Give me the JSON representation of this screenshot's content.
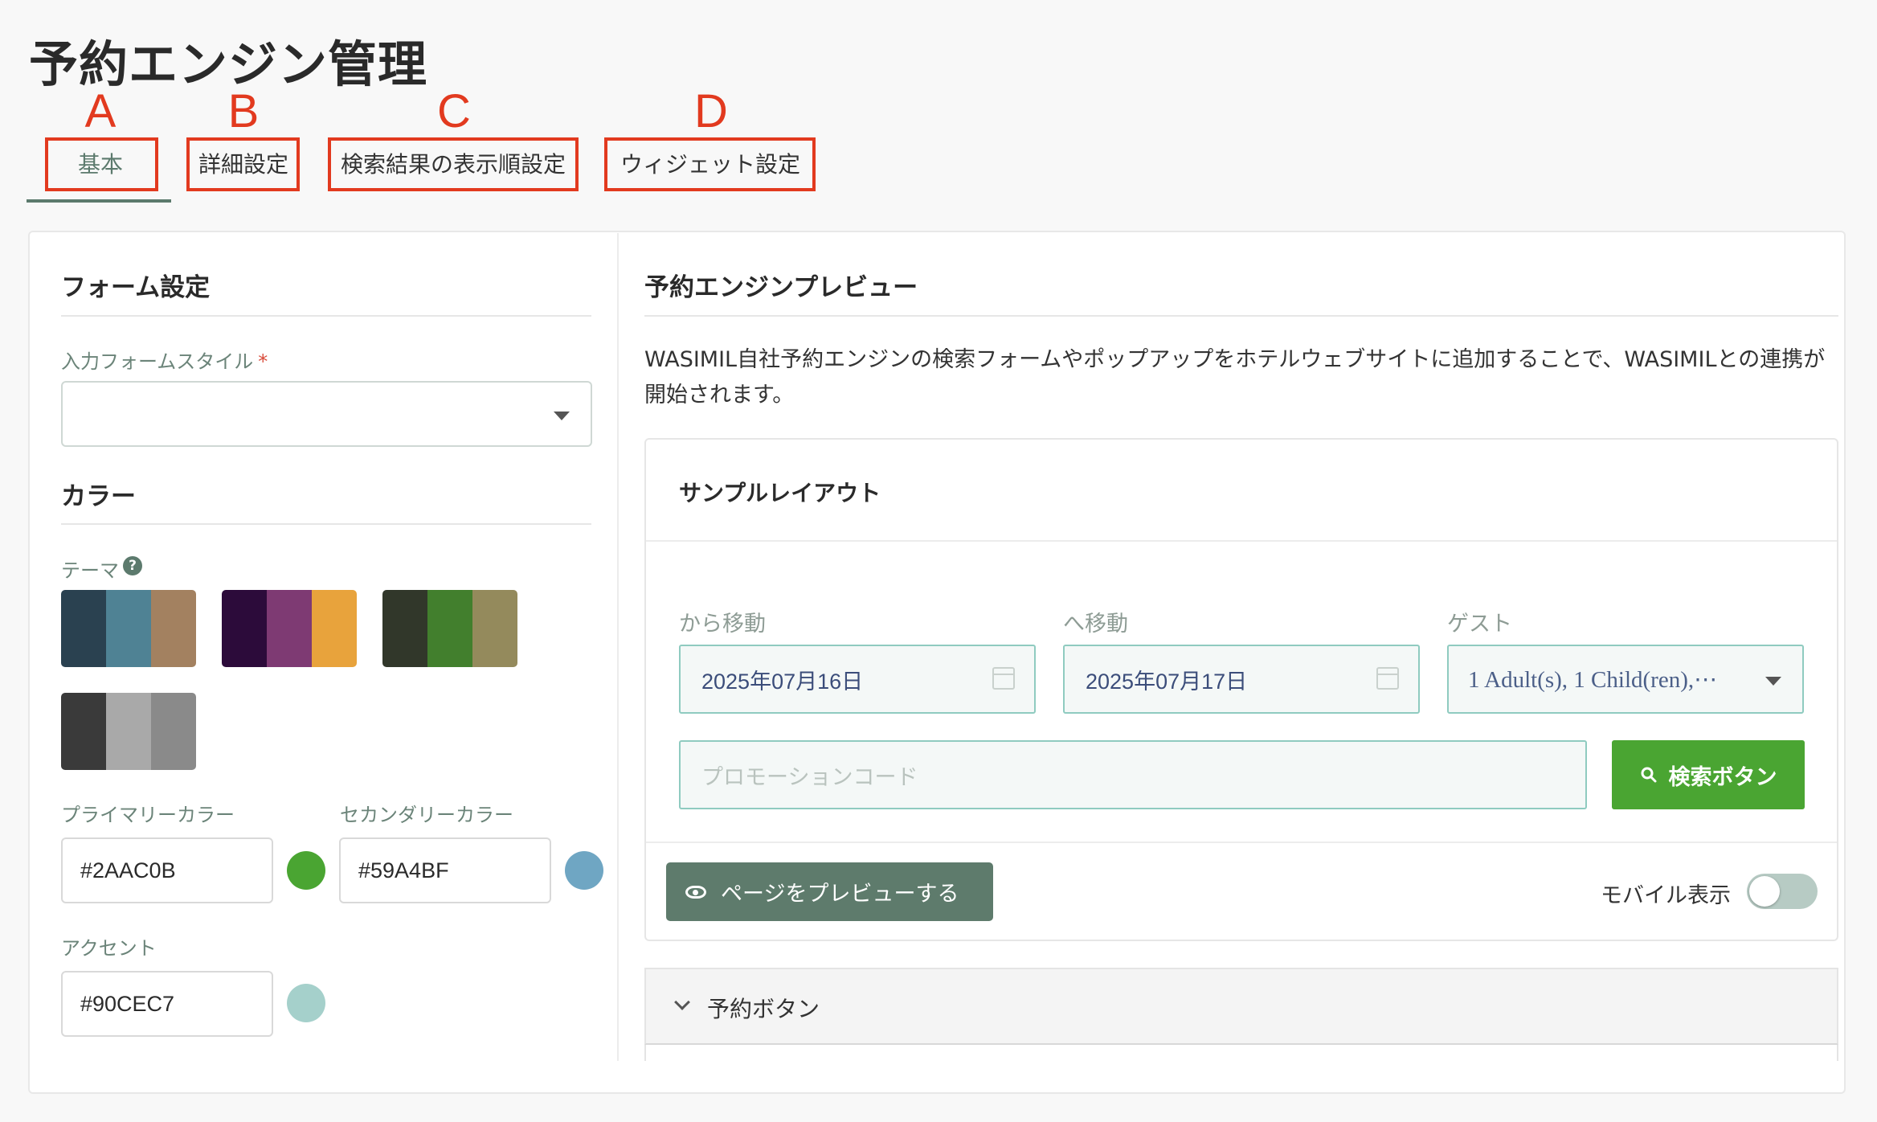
{
  "page": {
    "title": "予約エンジン管理"
  },
  "annotations": [
    "A",
    "B",
    "C",
    "D"
  ],
  "tabs": [
    {
      "label": "基本",
      "active": true
    },
    {
      "label": "詳細設定"
    },
    {
      "label": "検索結果の表示順設定"
    },
    {
      "label": "ウィジェット設定"
    }
  ],
  "form_settings": {
    "heading": "フォーム設定",
    "input_style_label": "入力フォームスタイル",
    "required_mark": "*",
    "input_style_value": ""
  },
  "color": {
    "heading": "カラー",
    "theme_label": "テーマ",
    "help_glyph": "?",
    "themes": [
      [
        "#2a4150",
        "#4f8294",
        "#a38160"
      ],
      [
        "#2c0b3a",
        "#7e3a73",
        "#e8a33c"
      ],
      [
        "#31372a",
        "#427f2d",
        "#948a5c"
      ],
      [
        "#3a3a3a",
        "#a9a9a9",
        "#8a8a8a"
      ]
    ],
    "primary_label": "プライマリーカラー",
    "primary_value": "#2AAC0B",
    "primary_dot": "#4aa532",
    "secondary_label": "セカンダリーカラー",
    "secondary_value": "#59A4BF",
    "secondary_dot": "#6fa6c3",
    "accent_label": "アクセント",
    "accent_value": "#90CEC7",
    "accent_dot": "#a5d0cb"
  },
  "preview": {
    "heading": "予約エンジンプレビュー",
    "description": "WASIMIL自社予約エンジンの検索フォームやポップアップをホテルウェブサイトに追加することで、WASIMILとの連携が開始されます。",
    "sample_layout_title": "サンプルレイアウト",
    "checkin_label": "から移動",
    "checkin_value": "2025年07月16日",
    "checkout_label": "へ移動",
    "checkout_value": "2025年07月17日",
    "guest_label": "ゲスト",
    "guest_value": "1 Adult(s), 1 Child(ren),⋯",
    "promo_placeholder": "プロモーションコード",
    "search_button": "検索ボタン",
    "preview_button": "ページをプレビューする",
    "mobile_label": "モバイル表示",
    "mobile_enabled": false,
    "accordion_label": "予約ボタン"
  }
}
